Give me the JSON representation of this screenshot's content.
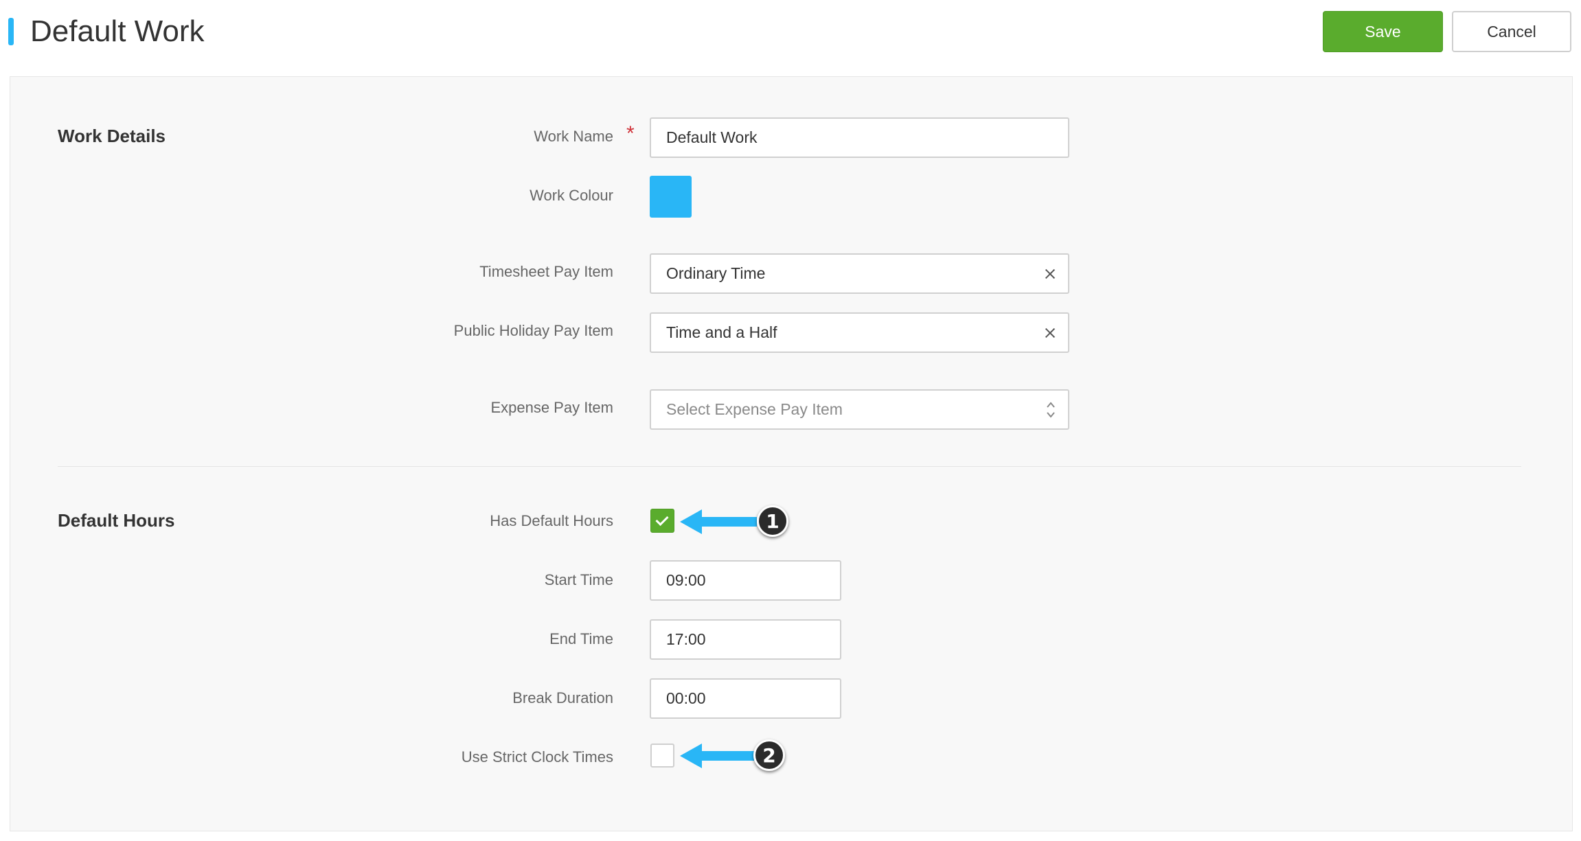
{
  "header": {
    "title": "Default Work",
    "save_label": "Save",
    "cancel_label": "Cancel"
  },
  "work_details": {
    "section_title": "Work Details",
    "work_name_label": "Work Name",
    "required_mark": "*",
    "work_name_value": "Default Work",
    "work_colour_label": "Work Colour",
    "work_colour_value": "#29b6f6",
    "timesheet_pay_item_label": "Timesheet Pay Item",
    "timesheet_pay_item_value": "Ordinary Time",
    "public_holiday_pay_item_label": "Public Holiday Pay Item",
    "public_holiday_pay_item_value": "Time and a Half",
    "expense_pay_item_label": "Expense Pay Item",
    "expense_pay_item_placeholder": "Select Expense Pay Item"
  },
  "default_hours": {
    "section_title": "Default Hours",
    "has_default_hours_label": "Has Default Hours",
    "has_default_hours_checked": true,
    "start_time_label": "Start Time",
    "start_time_value": "09:00",
    "end_time_label": "End Time",
    "end_time_value": "17:00",
    "break_duration_label": "Break Duration",
    "break_duration_value": "00:00",
    "strict_clock_times_label": "Use Strict Clock Times",
    "strict_clock_times_checked": false
  },
  "annotations": {
    "callout_1": "1",
    "callout_2": "2",
    "arrow_color": "#29b6f6"
  },
  "colors": {
    "accent": "#29b6f6",
    "save_button": "#5aac2d",
    "required": "#d0333a"
  }
}
